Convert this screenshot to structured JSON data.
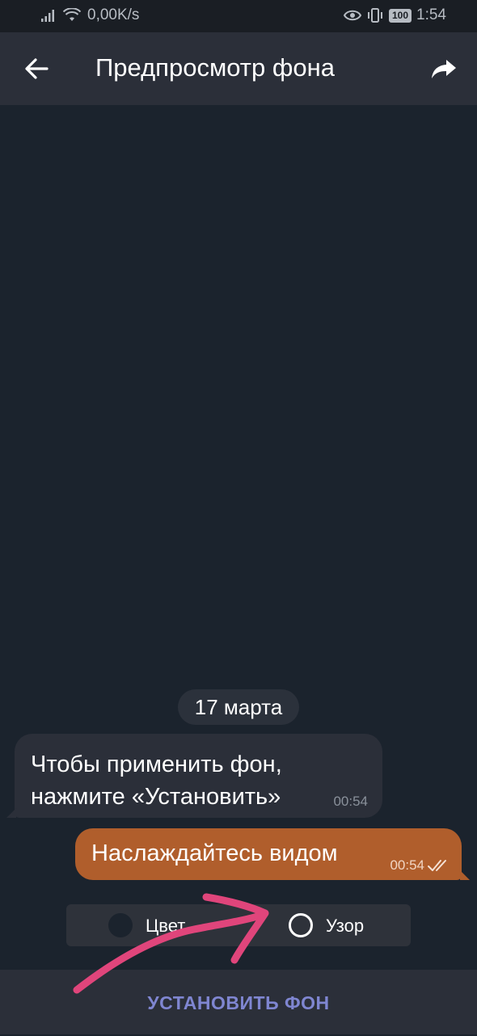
{
  "status_bar": {
    "network_speed": "0,00K/s",
    "battery": "100",
    "time": "1:54"
  },
  "app_bar": {
    "title": "Предпросмотр фона",
    "back_icon": "arrow-back-icon",
    "share_icon": "share-forward-icon"
  },
  "chat": {
    "date_label": "17 марта",
    "incoming": {
      "line1": "Чтобы применить фон,",
      "line2": "нажмите «Установить»",
      "time": "00:54"
    },
    "outgoing": {
      "text": "Наслаждайтесь видом",
      "time": "00:54"
    }
  },
  "toggle": {
    "color_label": "Цвет",
    "pattern_label": "Узор"
  },
  "bottom": {
    "set_button_label": "УСТАНОВИТЬ ФОН"
  },
  "colors": {
    "background": "#1b232d",
    "app_bar": "#2b2f39",
    "outgoing_bubble": "#b05e2c",
    "accent_button_text": "#7f86d1",
    "annotation_pink": "#e0457b"
  }
}
